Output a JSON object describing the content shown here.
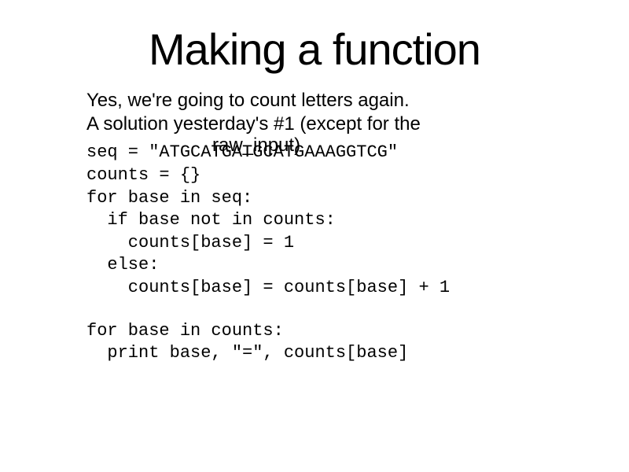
{
  "slide": {
    "title": "Making a function",
    "intro_line1": "Yes, we're going to count letters again.",
    "intro_line2": "A solution yesterday's #1 (except for the",
    "raw_input": "raw_input)",
    "code_line1": "seq = \"ATGCATGATGCATGAAAGGTCG\"",
    "code_block1": "counts = {}\nfor base in seq:\n  if base not in counts:\n    counts[base] = 1\n  else:\n    counts[base] = counts[base] + 1",
    "code_block2": "for base in counts:\n  print base, \"=\", counts[base]"
  }
}
